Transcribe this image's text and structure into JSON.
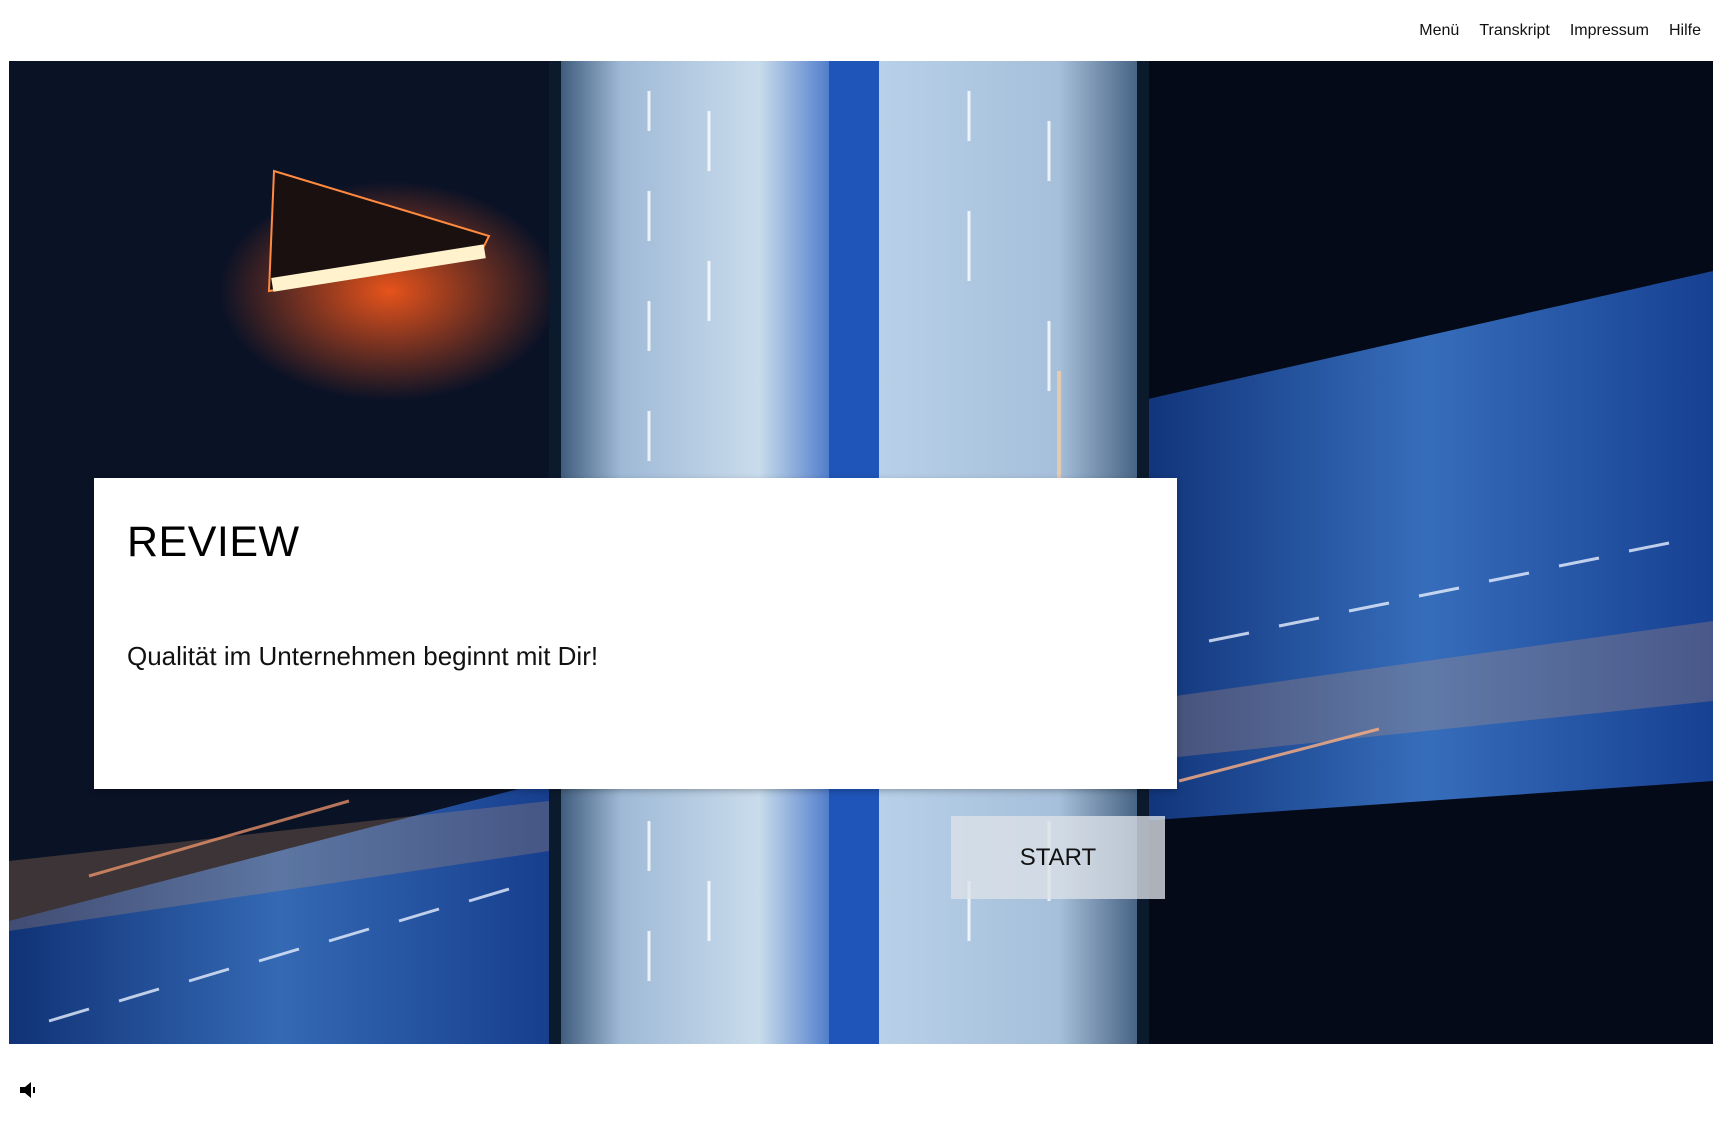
{
  "nav": {
    "items": [
      {
        "label": "Menü"
      },
      {
        "label": "Transkript"
      },
      {
        "label": "Impressum"
      },
      {
        "label": "Hilfe"
      }
    ]
  },
  "card": {
    "title": "REVIEW",
    "subtitle": "Qualität im Unternehmen beginnt mit Dir!"
  },
  "start_button": {
    "label": "START"
  },
  "sound": {
    "icon": "speaker-icon"
  },
  "colors": {
    "background_image_dark": "#050a18",
    "road_light": "#8fb4d8",
    "road_accent": "#1a4fb0",
    "lamp": "#ff6a2a"
  }
}
